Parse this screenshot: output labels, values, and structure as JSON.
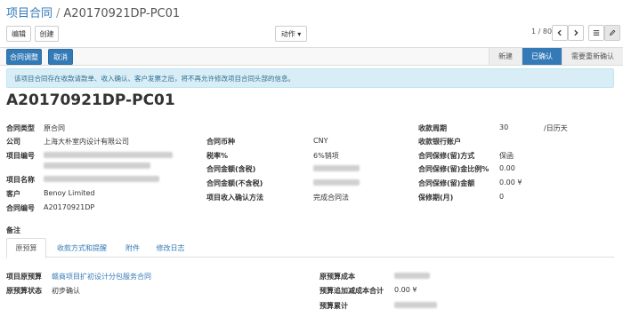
{
  "breadcrumb": {
    "parent": "项目合同",
    "separator": "/",
    "current": "A20170921DP-PC01"
  },
  "toolbar": {
    "edit_label": "编辑",
    "create_label": "创建",
    "action_label": "动作 ▾"
  },
  "pager": {
    "text": "1 / 80"
  },
  "controls": {
    "adjust_label": "合同调整",
    "cancel_label": "取消"
  },
  "status": {
    "items": [
      "新建",
      "已确认",
      "需要重新确认"
    ],
    "active": "已确认"
  },
  "alert": {
    "text": "该项目合同存在收款请款单、收入确认、客户发票之后，将不再允许修改项目合同头部的信息。"
  },
  "record": {
    "title": "A20170921DP-PC01"
  },
  "left": {
    "contract_type_label": "合同类型",
    "contract_type": "原合同",
    "company_label": "公司",
    "company": "上海大朴室内设计有限公司",
    "project_no_label": "项目编号",
    "project_name_label": "项目名称",
    "customer_label": "客户",
    "customer": "Benoy Limited",
    "contract_no_label": "合同编号",
    "contract_no": "A20170921DP"
  },
  "mid": {
    "currency_label": "合同币种",
    "currency": "CNY",
    "tax_label": "税率%",
    "tax": "6%销项",
    "amount_tax_label": "合同金额(含税)",
    "amount_notax_label": "合同金额(不含税)",
    "revenue_method_label": "项目收入确认方法",
    "revenue_method": "完成合同法"
  },
  "right": {
    "period_label": "收款周期",
    "period_value": "30",
    "period_unit": "/日历天",
    "bank_label": "收款银行账户",
    "retention_method_label": "合同保修(留)方式",
    "retention_method": "保函",
    "retention_ratio_label": "合同保修(留)金比例%",
    "retention_ratio": "0.00",
    "retention_amount_label": "合同保修(留)金额",
    "retention_amount": "0.00 ¥",
    "warranty_label": "保修期(月)",
    "warranty": "0"
  },
  "notes_label": "备注",
  "tabs": [
    "原预算",
    "收款方式和提醒",
    "附件",
    "修改日志"
  ],
  "budget": {
    "origin_label": "项目原预算",
    "origin": "赣商项目扩初设计分包服务合同",
    "state_label": "原预算状态",
    "state": "初步确认",
    "cost_label": "原预算成本",
    "adjust_label": "预算追加减成本合计",
    "adjust": "0.00 ¥",
    "total_label": "预算累计"
  }
}
